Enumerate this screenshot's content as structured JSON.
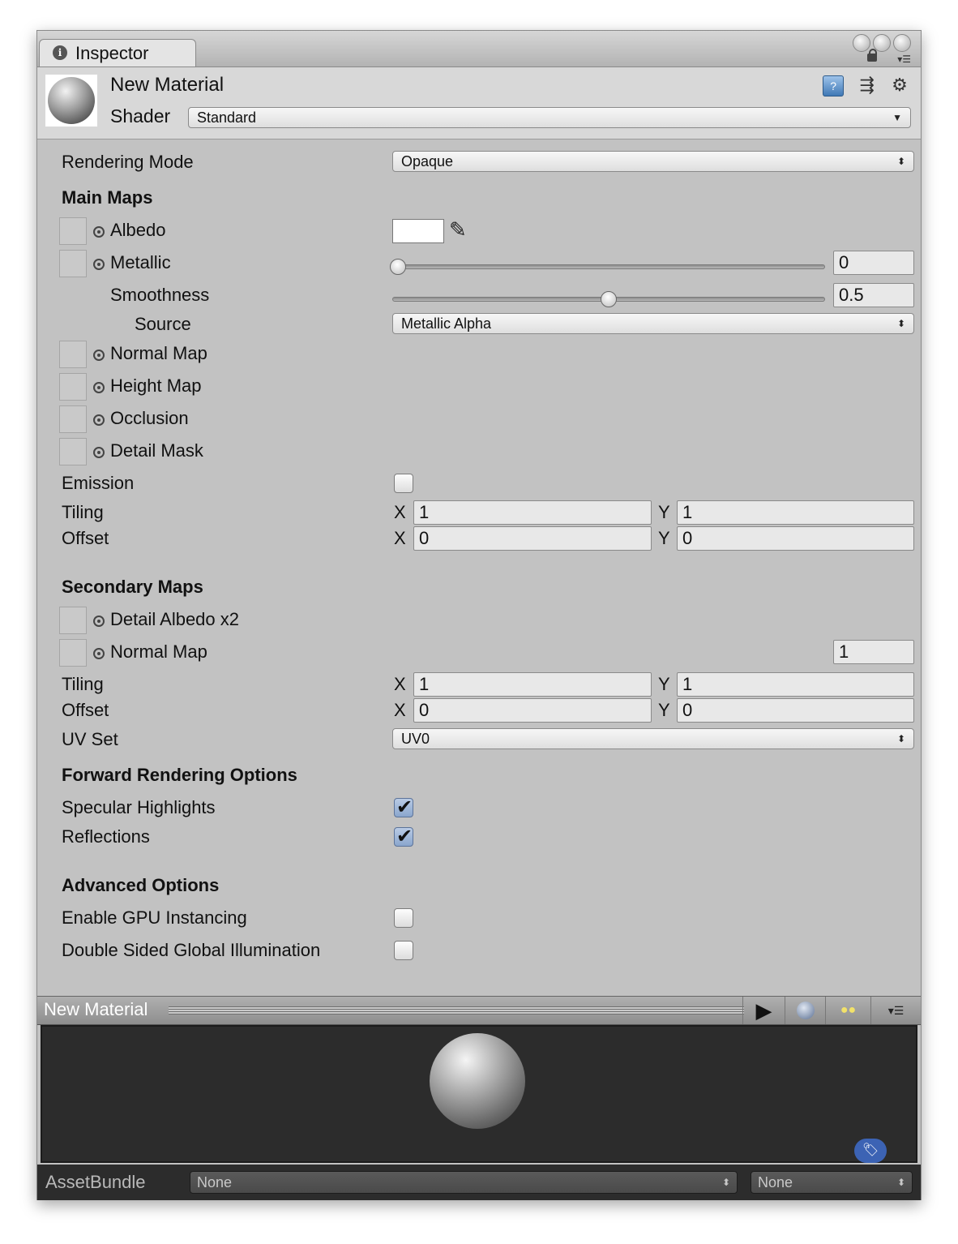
{
  "tab": {
    "label": "Inspector",
    "icon": "info-icon"
  },
  "header": {
    "title": "New Material",
    "shader_label": "Shader",
    "shader_value": "Standard"
  },
  "rendering_mode": {
    "label": "Rendering Mode",
    "value": "Opaque"
  },
  "main_maps": {
    "heading": "Main Maps",
    "albedo": "Albedo",
    "albedo_color": "#ffffff",
    "metallic": {
      "label": "Metallic",
      "value": "0",
      "fraction": 0
    },
    "smoothness": {
      "label": "Smoothness",
      "value": "0.5",
      "fraction": 0.5
    },
    "source": {
      "label": "Source",
      "value": "Metallic Alpha"
    },
    "normal_map": "Normal Map",
    "height_map": "Height Map",
    "occlusion": "Occlusion",
    "detail_mask": "Detail Mask",
    "emission": {
      "label": "Emission",
      "checked": false
    },
    "tiling": {
      "label": "Tiling",
      "x_label": "X",
      "x": "1",
      "y_label": "Y",
      "y": "1"
    },
    "offset": {
      "label": "Offset",
      "x_label": "X",
      "x": "0",
      "y_label": "Y",
      "y": "0"
    }
  },
  "secondary_maps": {
    "heading": "Secondary Maps",
    "detail_albedo": "Detail Albedo x2",
    "normal_map": {
      "label": "Normal Map",
      "value": "1"
    },
    "tiling": {
      "label": "Tiling",
      "x_label": "X",
      "x": "1",
      "y_label": "Y",
      "y": "1"
    },
    "offset": {
      "label": "Offset",
      "x_label": "X",
      "x": "0",
      "y_label": "Y",
      "y": "0"
    },
    "uv_set": {
      "label": "UV Set",
      "value": "UV0"
    }
  },
  "forward": {
    "heading": "Forward Rendering Options",
    "specular": {
      "label": "Specular Highlights",
      "checked": true
    },
    "reflections": {
      "label": "Reflections",
      "checked": true
    }
  },
  "advanced": {
    "heading": "Advanced Options",
    "gpu_instancing": {
      "label": "Enable GPU Instancing",
      "checked": false
    },
    "double_sided_gi": {
      "label": "Double Sided Global Illumination",
      "checked": false
    }
  },
  "preview": {
    "title": "New Material"
  },
  "assetbundle": {
    "label": "AssetBundle",
    "name": "None",
    "variant": "None"
  }
}
